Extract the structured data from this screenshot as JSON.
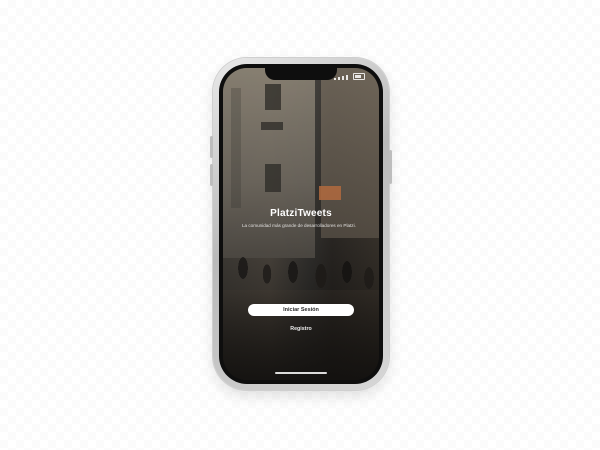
{
  "app": {
    "title": "PlatziTweets",
    "subtitle": "La comunidad más grande de desarrolladores en Platzi."
  },
  "actions": {
    "login_label": "Iniciar Sesión",
    "register_label": "Registro"
  },
  "icons": {
    "signal": "cellular-signal-icon",
    "battery": "battery-icon"
  },
  "colors": {
    "button_bg": "#ffffff",
    "button_text": "#2b2b2b",
    "text_primary": "#ffffff"
  }
}
